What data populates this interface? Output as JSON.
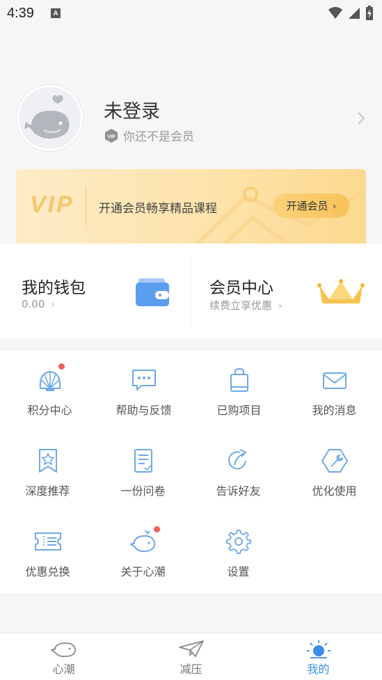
{
  "status_bar": {
    "time": "4:39",
    "notif_glyph": "A"
  },
  "profile": {
    "name": "未登录",
    "vip_badge": "VIP",
    "vip_status": "你还不是会员"
  },
  "vip_banner": {
    "logo": "VIP",
    "promo": "开通会员畅享精品课程",
    "button": "开通会员"
  },
  "wallet": {
    "title": "我的钱包",
    "balance": "0.00"
  },
  "member": {
    "title": "会员中心",
    "subtitle": "续费立享优惠"
  },
  "grid": [
    {
      "label": "积分中心",
      "icon": "shell-icon",
      "badge": true
    },
    {
      "label": "帮助与反馈",
      "icon": "chat-bubble-icon",
      "badge": false
    },
    {
      "label": "已购项目",
      "icon": "shopping-bag-icon",
      "badge": false
    },
    {
      "label": "我的消息",
      "icon": "envelope-icon",
      "badge": false
    },
    {
      "label": "深度推荐",
      "icon": "bookmark-star-icon",
      "badge": false
    },
    {
      "label": "一份问卷",
      "icon": "questionnaire-icon",
      "badge": false
    },
    {
      "label": "告诉好友",
      "icon": "share-icon",
      "badge": false
    },
    {
      "label": "优化使用",
      "icon": "wrench-icon",
      "badge": false
    },
    {
      "label": "优惠兑换",
      "icon": "ticket-icon",
      "badge": false
    },
    {
      "label": "关于心潮",
      "icon": "whale-icon",
      "badge": true
    },
    {
      "label": "设置",
      "icon": "gear-icon",
      "badge": false
    }
  ],
  "tabbar": [
    {
      "label": "心潮",
      "icon": "whale-icon",
      "active": false
    },
    {
      "label": "减压",
      "icon": "paper-plane-icon",
      "active": false
    },
    {
      "label": "我的",
      "icon": "sun-icon",
      "active": true
    }
  ],
  "colors": {
    "accent": "#3a8ee6",
    "gold": "#f8c25a",
    "badge_red": "#f06060"
  }
}
